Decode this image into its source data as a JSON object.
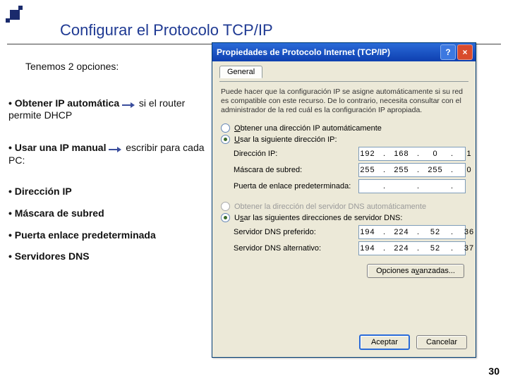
{
  "slide": {
    "title": "Configurar el Protocolo TCP/IP",
    "intro": "Tenemos 2 opciones:",
    "bullet1a": "• Obtener IP automática",
    "bullet1b": "si el router permite DHCP",
    "bullet2a": "• Usar una IP manual",
    "bullet2b": "escribir para cada PC:",
    "list1": "• Dirección IP",
    "list2": "• Máscara de subred",
    "list3": "• Puerta enlace predeterminada",
    "list4": "• Servidores DNS",
    "page": "30"
  },
  "dialog": {
    "title": "Propiedades de Protocolo Internet (TCP/IP)",
    "help": "?",
    "close": "×",
    "tab": "General",
    "description": "Puede hacer que la configuración IP se asigne automáticamente si su red es compatible con este recurso. De lo contrario, necesita consultar con el administrador de la red cuál es la configuración IP apropiada.",
    "radio_auto_ip": "Obtener una dirección IP automáticamente",
    "radio_manual_ip": "Usar la siguiente dirección IP:",
    "label_ip": "Dirección IP:",
    "label_mask": "Máscara de subred:",
    "label_gateway": "Puerta de enlace predeterminada:",
    "radio_auto_dns": "Obtener la dirección del servidor DNS automáticamente",
    "radio_manual_dns": "Usar las siguientes direcciones de servidor DNS:",
    "label_dns1": "Servidor DNS preferido:",
    "label_dns2": "Servidor DNS alternativo:",
    "advanced": "Opciones avanzadas...",
    "accept": "Aceptar",
    "cancel": "Cancelar",
    "ip": {
      "a": "192",
      "b": "168",
      "c": "0",
      "d": "1"
    },
    "mask": {
      "a": "255",
      "b": "255",
      "c": "255",
      "d": "0"
    },
    "gateway": {
      "a": "",
      "b": "",
      "c": "",
      "d": ""
    },
    "dns1": {
      "a": "194",
      "b": "224",
      "c": "52",
      "d": "36"
    },
    "dns2": {
      "a": "194",
      "b": "224",
      "c": "52",
      "d": "37"
    }
  }
}
